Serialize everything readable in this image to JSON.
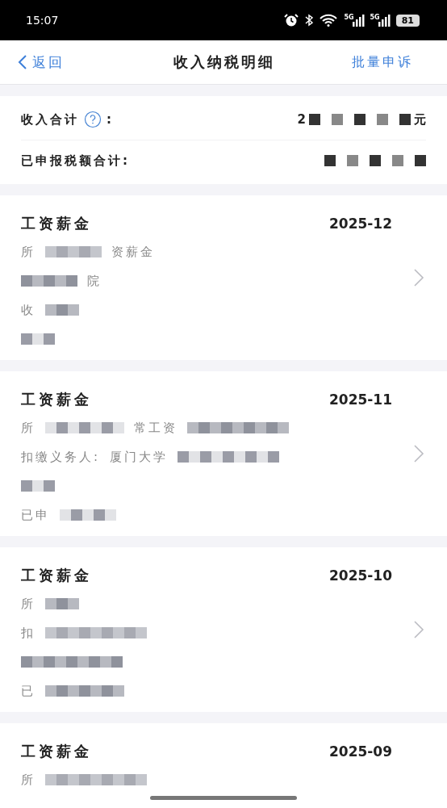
{
  "status_bar": {
    "time": "15:07",
    "signals": [
      {
        "label": "5G"
      },
      {
        "label": "5G"
      }
    ],
    "battery": "81"
  },
  "nav": {
    "back": "返回",
    "title": "收入纳税明细",
    "action": "批量申诉"
  },
  "summary": [
    {
      "label": "收入合计",
      "help": true,
      "colon": ":",
      "value": [
        {
          "kind": "text",
          "text": "2"
        },
        {
          "kind": "redacted"
        },
        {
          "kind": "text",
          "text": "元"
        }
      ]
    },
    {
      "label": "已申报税额合计:",
      "help": false,
      "value": [
        {
          "kind": "redacted"
        }
      ]
    }
  ],
  "records": [
    {
      "title": "工资薪金",
      "date": "2025-12",
      "lines": [
        [
          {
            "kind": "text",
            "text": "所"
          },
          {
            "kind": "redacted"
          },
          {
            "kind": "text",
            "text": "资薪金"
          }
        ],
        [
          {
            "kind": "redacted"
          },
          {
            "kind": "text",
            "text": "院"
          }
        ],
        [
          {
            "kind": "text",
            "text": "收"
          },
          {
            "kind": "redacted"
          }
        ],
        [
          {
            "kind": "redacted"
          }
        ]
      ]
    },
    {
      "title": "工资薪金",
      "date": "2025-11",
      "lines": [
        [
          {
            "kind": "text",
            "text": "所"
          },
          {
            "kind": "redacted"
          },
          {
            "kind": "text",
            "text": "常工资"
          },
          {
            "kind": "redacted"
          }
        ],
        [
          {
            "kind": "text",
            "text": "扣缴义务人:"
          },
          {
            "kind": "text",
            "text": "厦门大学"
          },
          {
            "kind": "redacted"
          }
        ],
        [
          {
            "kind": "redacted"
          }
        ],
        [
          {
            "kind": "text",
            "text": "已申"
          },
          {
            "kind": "redacted"
          }
        ]
      ]
    },
    {
      "title": "工资薪金",
      "date": "2025-10",
      "lines": [
        [
          {
            "kind": "text",
            "text": "所"
          },
          {
            "kind": "redacted"
          }
        ],
        [
          {
            "kind": "text",
            "text": "扣"
          },
          {
            "kind": "redacted"
          }
        ],
        [
          {
            "kind": "redacted"
          }
        ],
        [
          {
            "kind": "text",
            "text": "已"
          },
          {
            "kind": "redacted"
          }
        ]
      ]
    },
    {
      "title": "工资薪金",
      "date": "2025-09",
      "lines": [
        [
          {
            "kind": "text",
            "text": "所"
          },
          {
            "kind": "redacted"
          }
        ]
      ]
    }
  ]
}
